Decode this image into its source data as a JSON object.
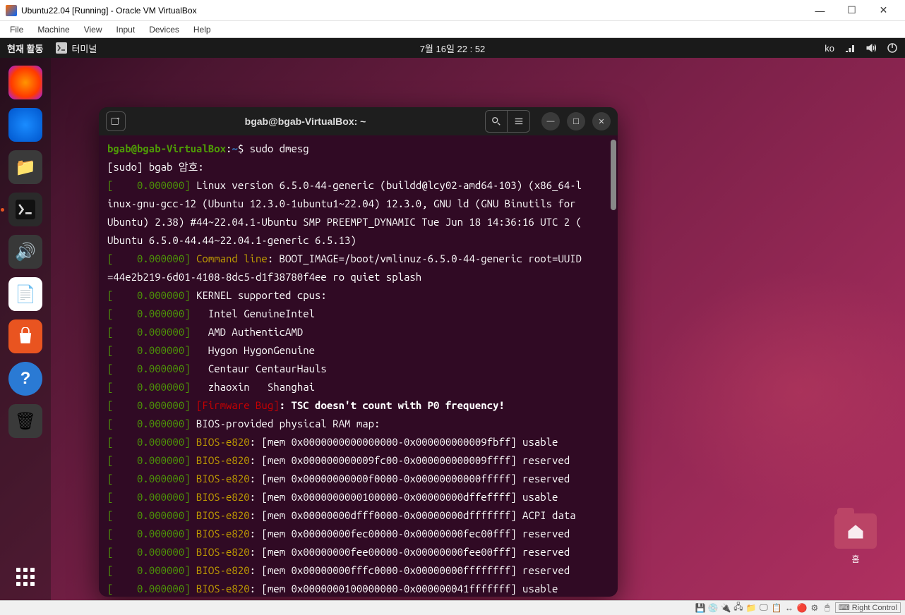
{
  "vbox": {
    "title": "Ubuntu22.04 [Running] - Oracle VM VirtualBox",
    "menu": [
      "File",
      "Machine",
      "View",
      "Input",
      "Devices",
      "Help"
    ],
    "host_key": "Right Control"
  },
  "gnome": {
    "activities": "현재 활동",
    "app_name": "터미널",
    "clock": "7월 16일  22 : 52",
    "lang": "ko"
  },
  "dock": {
    "items": [
      {
        "name": "firefox-icon",
        "label": "Firefox"
      },
      {
        "name": "thunderbird-icon",
        "label": "Thunderbird"
      },
      {
        "name": "files-icon",
        "label": "Files"
      },
      {
        "name": "terminal-icon",
        "label": "Terminal",
        "active": true
      },
      {
        "name": "rhythmbox-icon",
        "label": "Rhythmbox"
      },
      {
        "name": "libreoffice-icon",
        "label": "LibreOffice Writer"
      },
      {
        "name": "software-icon",
        "label": "Ubuntu Software"
      },
      {
        "name": "help-icon",
        "label": "Help"
      },
      {
        "name": "trash-icon",
        "label": "Trash"
      }
    ]
  },
  "desktop": {
    "home_label": "홈"
  },
  "terminal": {
    "title": "bgab@bgab-VirtualBox: ~",
    "prompt_user": "bgab@bgab-VirtualBox",
    "prompt_path": "~",
    "command": "sudo dmesg",
    "sudo_prompt": "[sudo] bgab 암호:",
    "lines": [
      {
        "ts": "0.000000",
        "text": "Linux version 6.5.0-44-generic (buildd@lcy02-amd64-103) (x86_64-l"
      },
      {
        "cont": "inux-gnu-gcc-12 (Ubuntu 12.3.0-1ubuntu1~22.04) 12.3.0, GNU ld (GNU Binutils for"
      },
      {
        "cont": "Ubuntu) 2.38) #44~22.04.1-Ubuntu SMP PREEMPT_DYNAMIC Tue Jun 18 14:36:16 UTC 2 ("
      },
      {
        "cont": "Ubuntu 6.5.0-44.44~22.04.1-generic 6.5.13)"
      },
      {
        "ts": "0.000000",
        "cmd": "Command line",
        "text": ": BOOT_IMAGE=/boot/vmlinuz-6.5.0-44-generic root=UUID"
      },
      {
        "cont": "=44e2b219-6d01-4108-8dc5-d1f38780f4ee ro quiet splash"
      },
      {
        "ts": "0.000000",
        "text": "KERNEL supported cpus:"
      },
      {
        "ts": "0.000000",
        "text": "  Intel GenuineIntel"
      },
      {
        "ts": "0.000000",
        "text": "  AMD AuthenticAMD"
      },
      {
        "ts": "0.000000",
        "text": "  Hygon HygonGenuine"
      },
      {
        "ts": "0.000000",
        "text": "  Centaur CentaurHauls"
      },
      {
        "ts": "0.000000",
        "text": "  zhaoxin   Shanghai"
      },
      {
        "ts": "0.000000",
        "fw": "[Firmware Bug]",
        "bold": ": TSC doesn't count with P0 frequency!"
      },
      {
        "ts": "0.000000",
        "text": "BIOS-provided physical RAM map:"
      },
      {
        "ts": "0.000000",
        "bios": "BIOS-e820",
        "text": ": [mem 0x0000000000000000-0x000000000009fbff] usable"
      },
      {
        "ts": "0.000000",
        "bios": "BIOS-e820",
        "text": ": [mem 0x000000000009fc00-0x000000000009ffff] reserved"
      },
      {
        "ts": "0.000000",
        "bios": "BIOS-e820",
        "text": ": [mem 0x00000000000f0000-0x00000000000fffff] reserved"
      },
      {
        "ts": "0.000000",
        "bios": "BIOS-e820",
        "text": ": [mem 0x0000000000100000-0x00000000dffeffff] usable"
      },
      {
        "ts": "0.000000",
        "bios": "BIOS-e820",
        "text": ": [mem 0x00000000dfff0000-0x00000000dfffffff] ACPI data"
      },
      {
        "ts": "0.000000",
        "bios": "BIOS-e820",
        "text": ": [mem 0x00000000fec00000-0x00000000fec00fff] reserved"
      },
      {
        "ts": "0.000000",
        "bios": "BIOS-e820",
        "text": ": [mem 0x00000000fee00000-0x00000000fee00fff] reserved"
      },
      {
        "ts": "0.000000",
        "bios": "BIOS-e820",
        "text": ": [mem 0x00000000fffc0000-0x00000000ffffffff] reserved"
      },
      {
        "ts": "0.000000",
        "bios": "BIOS-e820",
        "text": ": [mem 0x0000000100000000-0x000000041fffffff] usable"
      }
    ]
  }
}
